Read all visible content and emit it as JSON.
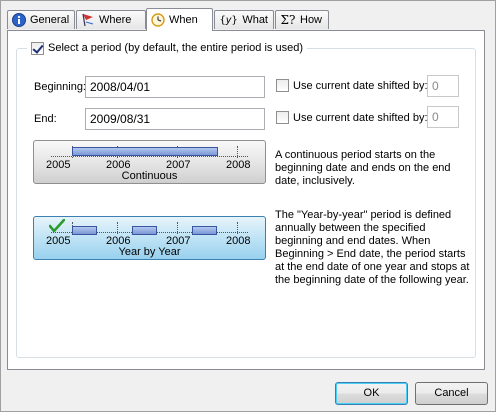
{
  "tabs": [
    {
      "label": "General",
      "icon": "info-icon"
    },
    {
      "label": "Where",
      "icon": "flag-icon"
    },
    {
      "label": "When",
      "icon": "clock-icon",
      "active": true
    },
    {
      "label": "What",
      "icon": "variable-icon"
    },
    {
      "label": "How",
      "icon": "sigma-icon"
    }
  ],
  "period": {
    "checkbox_label": "Select a period (by default, the entire period is used)",
    "checked": true
  },
  "beginning": {
    "label": "Beginning:",
    "value": "2008/04/01",
    "shift_label": "Use current date shifted by:",
    "shift_value": "0"
  },
  "end": {
    "label": "End:",
    "value": "2009/08/31",
    "shift_label": "Use current date shifted by:",
    "shift_value": "0"
  },
  "continuous": {
    "caption": "Continuous",
    "years": [
      "2005",
      "2006",
      "2007",
      "2008"
    ],
    "description": "A continuous period starts on the beginning date and ends on the end date, inclusively."
  },
  "year_by_year": {
    "caption": "Year by Year",
    "years": [
      "2005",
      "2006",
      "2007",
      "2008"
    ],
    "selected": true,
    "description": "The \"Year-by-year\" period is defined annually between the specified beginning and end dates. When Beginning > End date, the period starts at the end date of one year and stops at the beginning date of the following year."
  },
  "buttons": {
    "ok": "OK",
    "cancel": "Cancel"
  },
  "colors": {
    "accent": "#3c7fb1",
    "bar_fill": "#7b98d6",
    "check_green": "#2e9b2e"
  }
}
